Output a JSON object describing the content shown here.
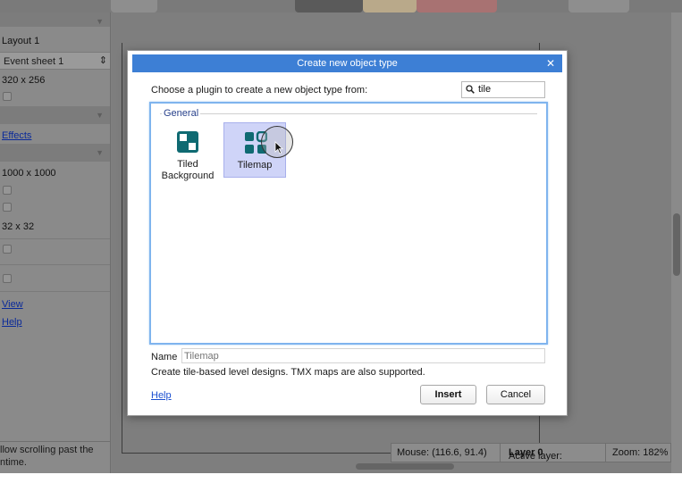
{
  "sidebar": {
    "layout_name": "Layout 1",
    "event_sheet": "Event sheet 1",
    "layout_size": "320 x 256",
    "effects_link": "Effects",
    "margin_size": "1000 x 1000",
    "grid_size": "32 x 32",
    "view_link": "View",
    "help_link": "Help",
    "footer_text_line1": "llow scrolling past the",
    "footer_text_line2": "ntime."
  },
  "statusbar": {
    "mouse": "Mouse: (116.6, 91.4)",
    "active_layer_label": "Active layer:",
    "active_layer_value": "Layer 0",
    "zoom": "Zoom: 182%"
  },
  "dialog": {
    "title": "Create new object type",
    "close_glyph": "✕",
    "prompt": "Choose a plugin to create a new object type from:",
    "search_value": "tile",
    "group_label": "General",
    "plugins": [
      {
        "label_line1": "Tiled",
        "label_line2": "Background",
        "icon": "tiled-background-icon",
        "selected": false
      },
      {
        "label_line1": "Tilemap",
        "label_line2": "",
        "icon": "tilemap-icon",
        "selected": true
      }
    ],
    "name_label": "Name",
    "name_placeholder": "Tilemap",
    "description": "Create tile-based level designs. TMX maps are also supported.",
    "help_label": "Help",
    "insert_label": "Insert",
    "cancel_label": "Cancel"
  },
  "colors": {
    "title_bar": "#3d7fd5",
    "icon_teal": "#0f6a72",
    "selection": "#cfd4f8",
    "list_border": "#7fb4ee"
  }
}
